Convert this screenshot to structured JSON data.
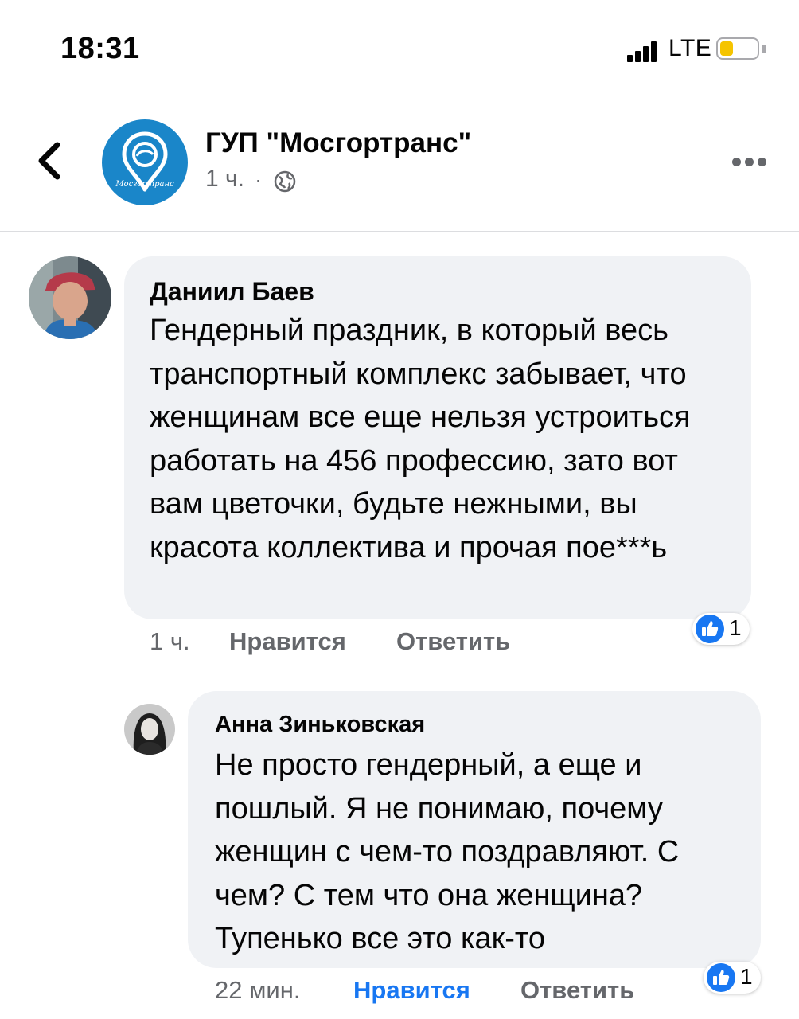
{
  "status_bar": {
    "time": "18:31",
    "network": "LTE",
    "battery_level": 0.35,
    "battery_color": "#f5c400"
  },
  "post": {
    "page_name": "ГУП \"Мосгортранс\"",
    "time": "1 ч.",
    "separator": "·",
    "audience_icon": "globe-icon",
    "logo_text": "Мосгортранс",
    "logo_color": "#1a86c9"
  },
  "comments": [
    {
      "author": "Даниил Баев",
      "text": "Гендерный праздник, в который весь транспортный комплекс забывает, что женщинам все еще нельзя устроиться работать на 456 профессию, зато вот вам цветочки, будьте нежными, вы красота коллектива и прочая пое***ь",
      "time": "1 ч.",
      "like_label": "Нравится",
      "reply_label": "Ответить",
      "reaction_count": "1",
      "liked_by_me": false
    },
    {
      "author": "Анна Зиньковская",
      "text": "Не просто гендерный, а еще и пошлый. Я не понимаю, почему женщин с чем-то поздравляют. С чем? С тем что она женщина? Тупенько все это как-то",
      "time": "22 мин.",
      "like_label": "Нравится",
      "reply_label": "Ответить",
      "reaction_count": "1",
      "liked_by_me": true
    }
  ],
  "colors": {
    "accent": "#1877f2",
    "bubble": "#f0f2f5",
    "secondary_text": "#65676b"
  }
}
